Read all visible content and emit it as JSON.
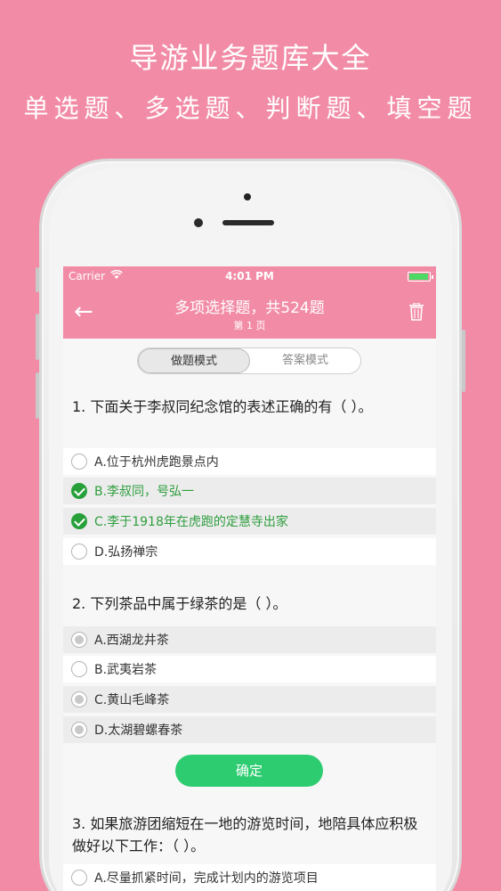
{
  "promo": {
    "title": "导游业务题库大全",
    "subtitle": "单选题、多选题、判断题、填空题"
  },
  "status_bar": {
    "carrier": "Carrier",
    "time": "4:01 PM"
  },
  "nav": {
    "back_icon": "←",
    "title": "多项选择题，共524题",
    "subtitle": "第 1 页"
  },
  "mode_segment": {
    "items": [
      "做题模式",
      "答案模式"
    ],
    "selected": "做题模式"
  },
  "questions": [
    {
      "text": "1. 下面关于李叔同纪念馆的表述正确的有（ ）。",
      "options": [
        {
          "label": "A.位于杭州虎跑景点内",
          "state": "unchecked"
        },
        {
          "label": "B.李叔同，号弘一",
          "state": "correct"
        },
        {
          "label": "C.李于1918年在虎跑的定慧寺出家",
          "state": "correct"
        },
        {
          "label": "D.弘扬禅宗",
          "state": "unchecked"
        }
      ]
    },
    {
      "text": "2. 下列茶品中属于绿茶的是（ ）。",
      "options": [
        {
          "label": "A.西湖龙井茶",
          "state": "selected"
        },
        {
          "label": "B.武夷岩茶",
          "state": "unchecked"
        },
        {
          "label": "C.黄山毛峰茶",
          "state": "selected"
        },
        {
          "label": "D.太湖碧螺春茶",
          "state": "selected"
        }
      ]
    },
    {
      "text": "3. 如果旅游团缩短在一地的游览时间，地陪具体应积极做好以下工作：（ ）。",
      "options": [
        {
          "label": "A.尽量抓紧时间，完成计划内的游览项目",
          "state": "unchecked"
        }
      ]
    }
  ],
  "confirm_label": "确定",
  "colors": {
    "brand_pink": "#f28ca6",
    "correct_green": "#27a03a",
    "button_green": "#2ecc71"
  }
}
